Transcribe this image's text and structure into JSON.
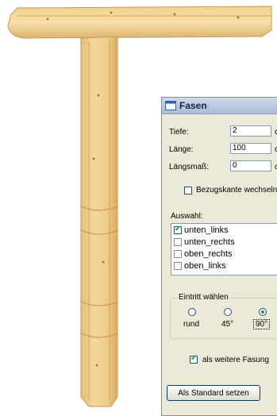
{
  "dialog": {
    "title": "Fasen",
    "fields": [
      {
        "label": "Tiefe:",
        "value": "2",
        "unit": "c"
      },
      {
        "label": "Länge:",
        "value": "100",
        "unit": "c"
      },
      {
        "label": "Längsmaß:",
        "value": "0",
        "unit": "c"
      }
    ],
    "bezugskante_label": "Bezugskante wechseln",
    "bezugskante_checked": false,
    "auswahl_label": "Auswahl:",
    "auswahl_items": [
      {
        "label": "unten_links",
        "checked": true
      },
      {
        "label": "unten_rechts",
        "checked": false
      },
      {
        "label": "oben_rechts",
        "checked": false
      },
      {
        "label": "oben_links",
        "checked": false
      }
    ],
    "eintritt_label": "Eintritt wählen",
    "eintritt_options": [
      {
        "label": "rund",
        "selected": false
      },
      {
        "label": "45°",
        "selected": false
      },
      {
        "label": "90°",
        "selected": true
      }
    ],
    "weitere_fasung_label": "als weitere Fasung",
    "weitere_fasung_checked": true,
    "standard_button": "Als Standard setzen"
  }
}
